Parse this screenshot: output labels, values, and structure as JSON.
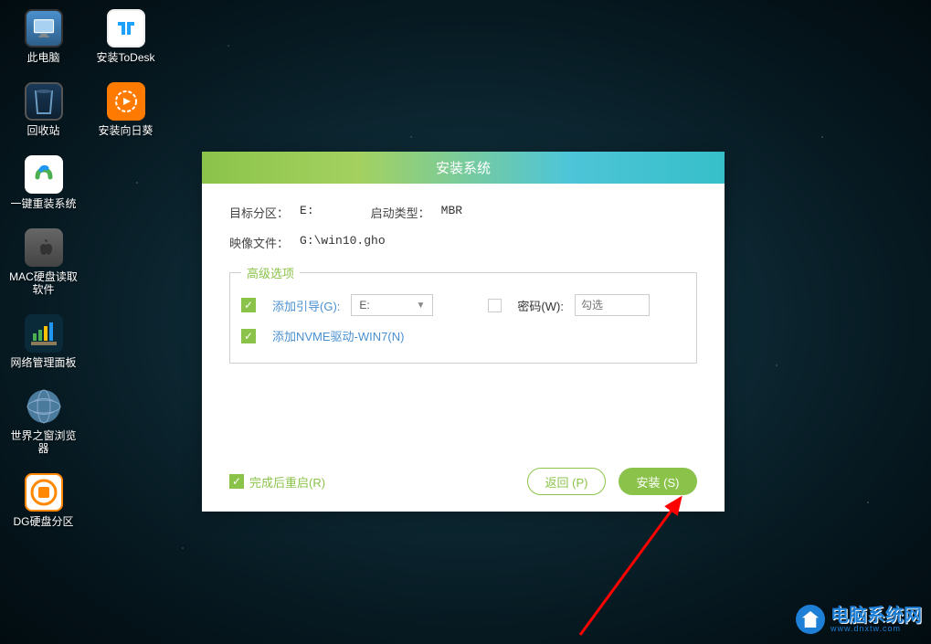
{
  "desktop": {
    "icons": [
      {
        "label": "此电脑"
      },
      {
        "label": "安装ToDesk"
      },
      {
        "label": "回收站"
      },
      {
        "label": "安装向日葵"
      },
      {
        "label": "一键重装系统"
      },
      {
        "label": "MAC硬盘读取软件"
      },
      {
        "label": "网络管理面板"
      },
      {
        "label": "世界之窗浏览器"
      },
      {
        "label": "DG硬盘分区"
      }
    ]
  },
  "dialog": {
    "title": "安装系统",
    "target_partition_label": "目标分区：",
    "target_partition_value": "E:",
    "boot_type_label": "启动类型：",
    "boot_type_value": "MBR",
    "image_file_label": "映像文件：",
    "image_file_value": "G:\\win10.gho",
    "advanced": {
      "legend": "高级选项",
      "add_boot_label": "添加引导(G):",
      "add_boot_value": "E:",
      "password_label": "密码(W):",
      "password_placeholder": "勾选",
      "nvme_label": "添加NVME驱动-WIN7(N)"
    },
    "restart_label": "完成后重启(R)",
    "btn_back": "返回 (P)",
    "btn_install": "安装 (S)"
  },
  "watermark": {
    "title": "电脑系统网",
    "url": "www.dnxtw.com"
  }
}
